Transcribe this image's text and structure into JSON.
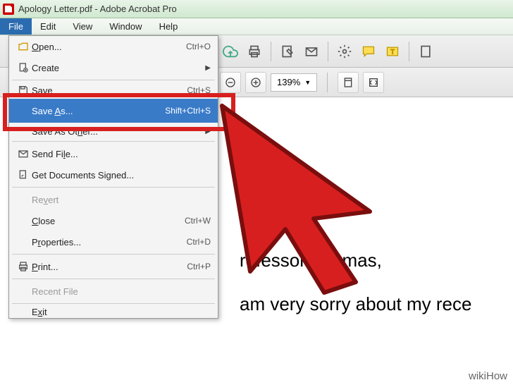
{
  "window": {
    "title": "Apology Letter.pdf - Adobe Acrobat Pro"
  },
  "menubar": {
    "file": "File",
    "edit": "Edit",
    "view": "View",
    "window": "Window",
    "help": "Help"
  },
  "toolbar2": {
    "zoom": "139%"
  },
  "dropdown": {
    "open": {
      "label": "Open...",
      "shortcut": "Ctrl+O"
    },
    "create": {
      "label": "Create"
    },
    "save": {
      "label": "Save",
      "shortcut": "Ctrl+S"
    },
    "save_as": {
      "label": "Save As...",
      "shortcut": "Shift+Ctrl+S"
    },
    "save_as_other": {
      "label": "Save As Other..."
    },
    "send_file": {
      "label": "Send File..."
    },
    "get_signed": {
      "label": "Get Documents Signed..."
    },
    "revert": {
      "label": "Revert"
    },
    "close": {
      "label": "Close",
      "shortcut": "Ctrl+W"
    },
    "properties": {
      "label": "Properties...",
      "shortcut": "Ctrl+D"
    },
    "print": {
      "label": "Print...",
      "shortcut": "Ctrl+P"
    },
    "recent": {
      "label": "Recent File"
    },
    "exit": {
      "label": "Exit"
    }
  },
  "document": {
    "line1": "rofessor Thomas,",
    "line2": "am very sorry about my rece"
  },
  "watermark": "wikiHow"
}
